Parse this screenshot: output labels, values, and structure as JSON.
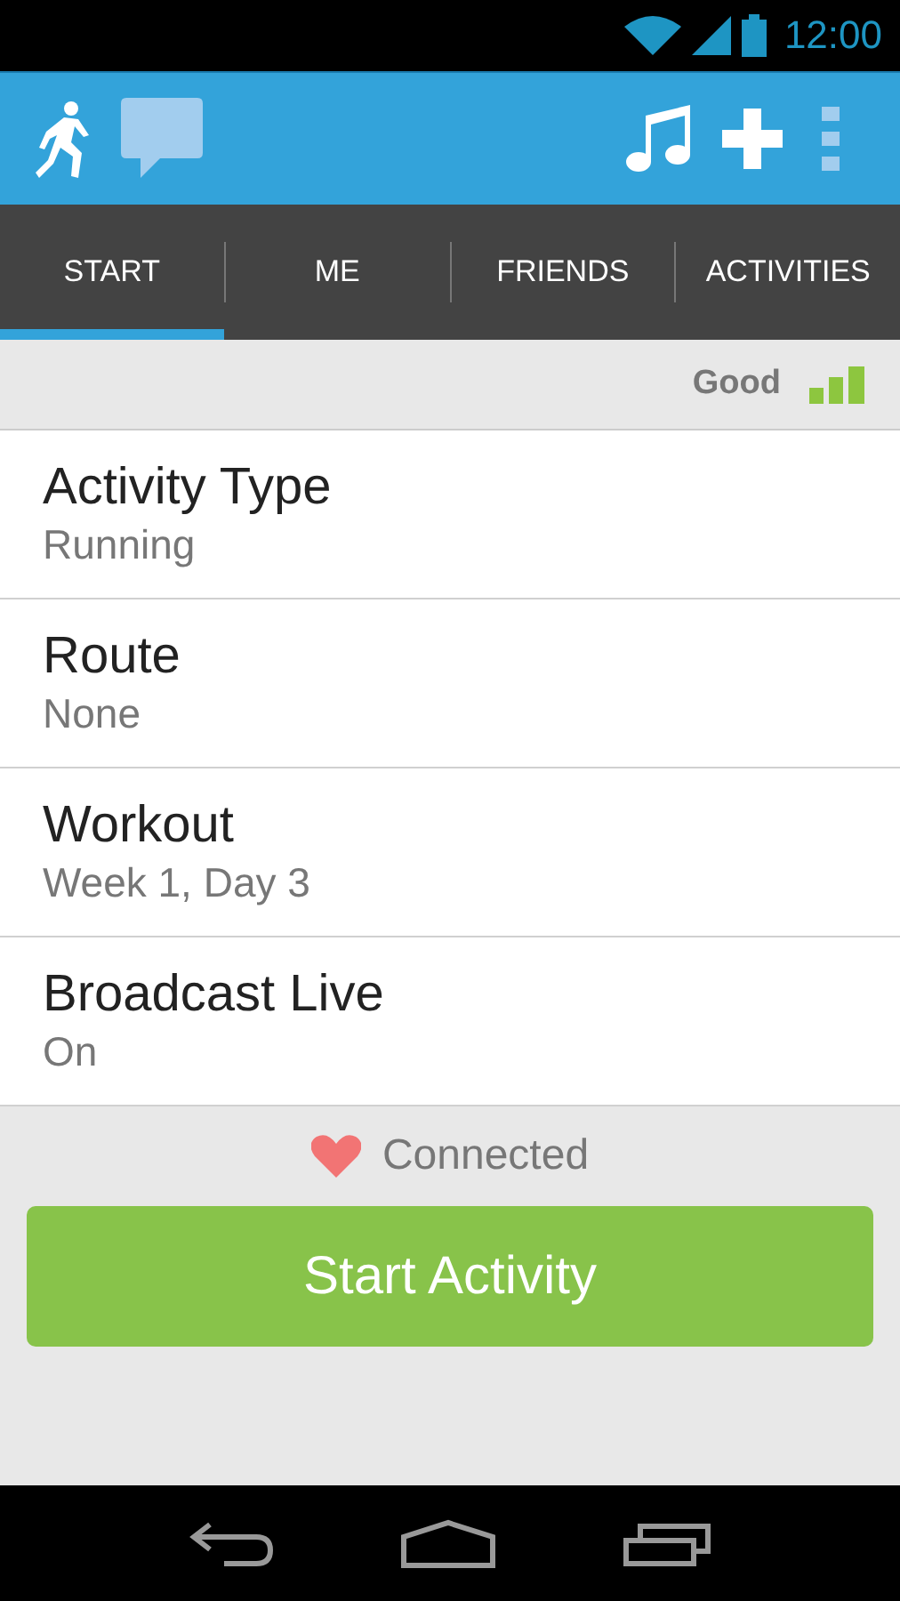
{
  "status_bar": {
    "time": "12:00"
  },
  "tabs": [
    {
      "label": "START",
      "selected": true
    },
    {
      "label": "ME",
      "selected": false
    },
    {
      "label": "FRIENDS",
      "selected": false
    },
    {
      "label": "ACTIVITIES",
      "selected": false
    }
  ],
  "gps": {
    "label": "Good"
  },
  "settings": [
    {
      "title": "Activity Type",
      "value": "Running"
    },
    {
      "title": "Route",
      "value": "None"
    },
    {
      "title": "Workout",
      "value": "Week 1, Day 3"
    },
    {
      "title": "Broadcast Live",
      "value": "On"
    }
  ],
  "heart_rate": {
    "label": "Connected"
  },
  "start_button": {
    "label": "Start Activity"
  }
}
